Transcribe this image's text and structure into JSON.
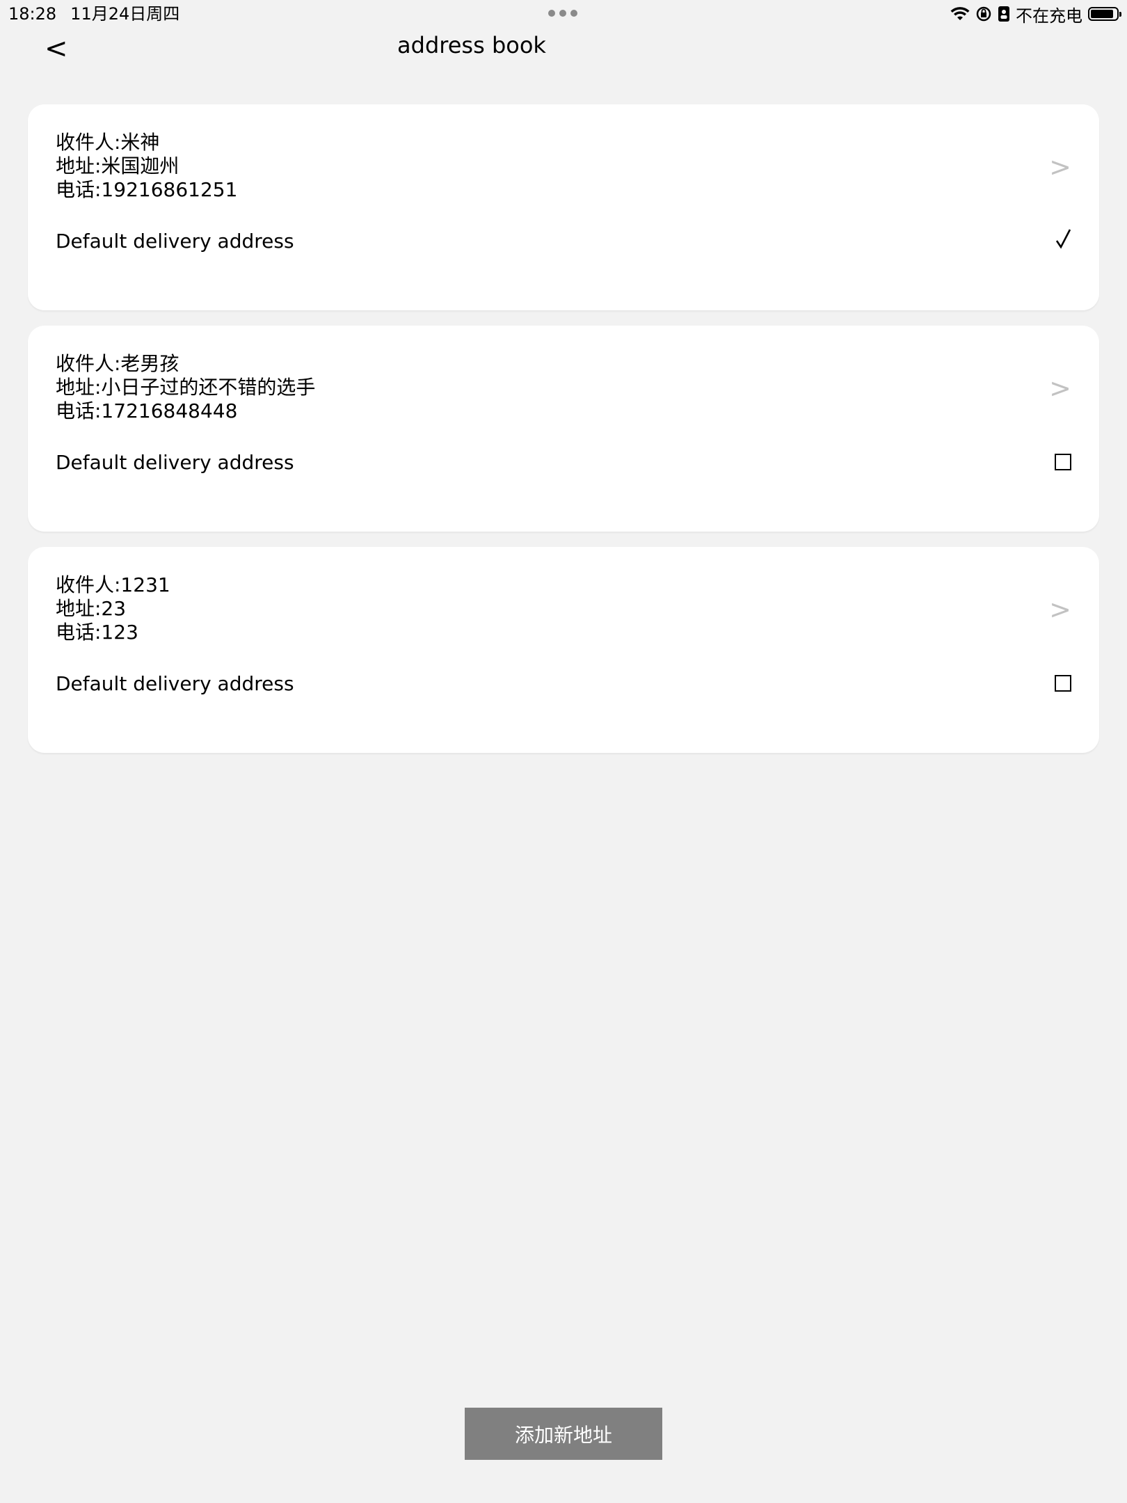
{
  "status_bar": {
    "time": "18:28",
    "date": "11月24日周四",
    "charging_status": "不在充电",
    "battery_level": 0.9
  },
  "nav": {
    "back_label": "<",
    "title": "address book"
  },
  "addresses": [
    {
      "recipient": "收件人:米神",
      "address": "地址:米国迦州",
      "phone": "电话:19216861251",
      "default_label": "Default delivery address",
      "is_default": true,
      "chevron": ">",
      "check_mark": "√"
    },
    {
      "recipient": "收件人:老男孩",
      "address": "地址:小日子过的还不错的选手",
      "phone": "电话:17216848448",
      "default_label": "Default delivery address",
      "is_default": false,
      "chevron": ">"
    },
    {
      "recipient": "收件人:1231",
      "address": "地址:23",
      "phone": "电话:123",
      "default_label": "Default delivery address",
      "is_default": false,
      "chevron": ">"
    }
  ],
  "add_button_label": "添加新地址",
  "colors": {
    "background": "#f2f2f2",
    "card": "#ffffff",
    "chevron": "#c2c2c2",
    "add_button": "#808080"
  }
}
